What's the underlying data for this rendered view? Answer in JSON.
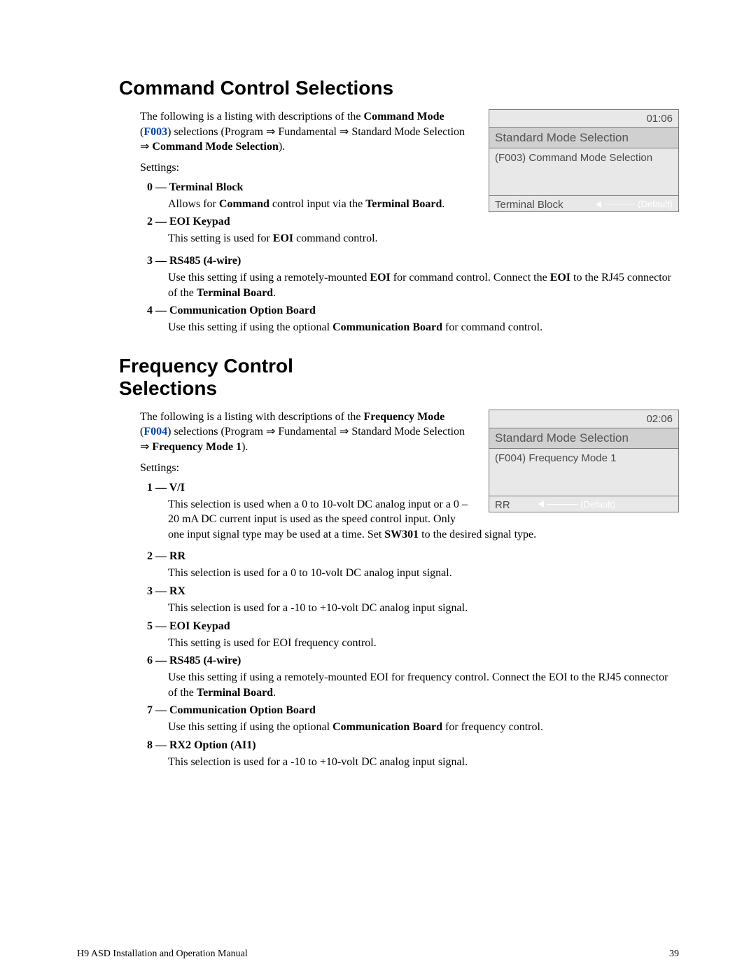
{
  "section1": {
    "heading": "Command Control Selections",
    "intro_pre": "The following is a listing with descriptions of the ",
    "intro_mode_label": "Command Mode",
    "intro_paren_open": " (",
    "intro_code": "F003",
    "intro_paren_close": ") selections (Program ⇒ Fundamental ⇒ Standard Mode Selection ⇒ ",
    "intro_trail_bold": "Command Mode Selection",
    "intro_end": ").",
    "settings_label": "Settings:",
    "items": [
      {
        "title": "0 — Terminal Block",
        "desc_pre": "Allows for ",
        "desc_b1": "Command",
        "desc_mid": " control input via the ",
        "desc_b2": "Terminal Board",
        "desc_end": "."
      },
      {
        "title": "2 — EOI Keypad",
        "desc_pre": "This setting is used for ",
        "desc_b1": "EOI",
        "desc_mid": " command control.",
        "desc_b2": "",
        "desc_end": ""
      },
      {
        "title": "3 — RS485 (4-wire)",
        "desc_pre": "Use this setting if using a remotely-mounted ",
        "desc_b1": "EOI",
        "desc_mid": " for command control. Connect the ",
        "desc_b2": "EOI",
        "desc_end": " to the RJ45 connector of the ",
        "desc_b3": "Terminal Board",
        "desc_tail": "."
      },
      {
        "title": "4 — Communication Option Board",
        "desc_pre": "Use this setting if using the optional ",
        "desc_b1": "Communication Board",
        "desc_mid": " for command control.",
        "desc_b2": "",
        "desc_end": ""
      }
    ],
    "panel": {
      "time": "01:06",
      "header": "Standard Mode Selection",
      "body": "(F003) Command Mode Selection",
      "value": "Terminal Block",
      "default": "(Default)"
    }
  },
  "section2": {
    "heading": "Frequency Control Selections",
    "intro_pre": "The following is a listing with descriptions of the ",
    "intro_mode_label": "Frequency Mode",
    "intro_paren_open": " (",
    "intro_code": "F004",
    "intro_paren_close": ") selections (Program ⇒ Fundamental ⇒ Standard Mode Selection ⇒ ",
    "intro_trail_bold": "Frequency Mode 1",
    "intro_end": ").",
    "settings_label": "Settings:",
    "items": [
      {
        "title": "1 — V/I",
        "desc": "This selection is used when a 0 to 10-volt DC analog input or a 0 – 20 mA DC current input is used as the speed control input. Only one input signal type may be used at a time. Set ",
        "desc_b": "SW301",
        "desc_tail": " to the desired signal type."
      },
      {
        "title": "2 — RR",
        "desc": "This selection is used for a 0 to 10-volt DC analog input signal."
      },
      {
        "title": "3 — RX",
        "desc": "This selection is used for a -10 to +10-volt DC analog input signal."
      },
      {
        "title": "5 — EOI Keypad",
        "desc": "This setting is used for EOI frequency control."
      },
      {
        "title": "6 — RS485 (4-wire)",
        "desc": "Use this setting if using a remotely-mounted EOI for frequency control. Connect the EOI to the RJ45 connector of the ",
        "desc_b": "Terminal Board",
        "desc_tail": "."
      },
      {
        "title": "7 — Communication Option Board",
        "desc": "Use this setting if using the optional ",
        "desc_b": "Communication Board",
        "desc_tail": " for frequency control."
      },
      {
        "title": "8 — RX2 Option (AI1)",
        "desc": "This selection is used for a -10 to +10-volt DC analog input signal."
      }
    ],
    "panel": {
      "time": "02:06",
      "header": "Standard Mode Selection",
      "body": "(F004) Frequency Mode 1",
      "value": "RR",
      "default": "(Default)"
    }
  },
  "footer": {
    "left": "H9 ASD Installation and Operation Manual",
    "right": "39"
  }
}
